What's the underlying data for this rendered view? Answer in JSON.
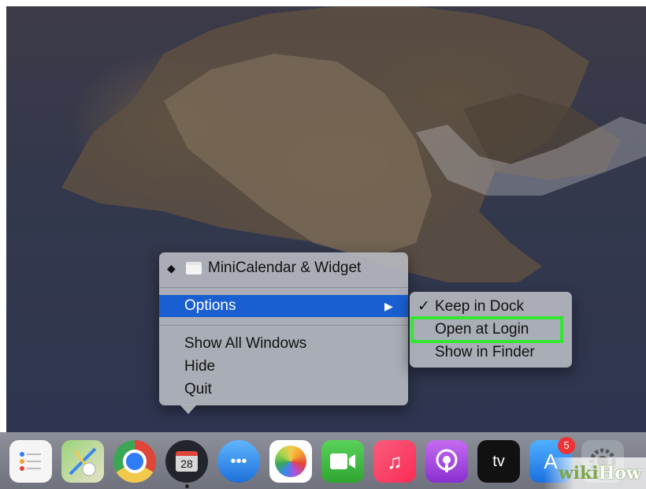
{
  "context_menu": {
    "app_title": "MiniCalendar & Widget",
    "items": [
      {
        "label": "Options",
        "selected": true,
        "has_submenu": true
      },
      {
        "label": "Show All Windows"
      },
      {
        "label": "Hide"
      },
      {
        "label": "Quit"
      }
    ]
  },
  "submenu": {
    "items": [
      {
        "label": "Keep in Dock",
        "checked": true
      },
      {
        "label": "Open at Login",
        "highlighted": true
      },
      {
        "label": "Show in Finder"
      }
    ]
  },
  "dock": {
    "icons": [
      {
        "name": "reminders",
        "icon": "list-icon"
      },
      {
        "name": "maps",
        "icon": "map-icon"
      },
      {
        "name": "chrome",
        "icon": "chrome-icon"
      },
      {
        "name": "minicalendar",
        "icon": "calendar-icon",
        "label": "28",
        "running": true
      },
      {
        "name": "messages",
        "icon": "chat-bubble-icon"
      },
      {
        "name": "photos",
        "icon": "flower-icon"
      },
      {
        "name": "facetime",
        "icon": "video-camera-icon"
      },
      {
        "name": "music",
        "icon": "music-note-icon"
      },
      {
        "name": "podcasts",
        "icon": "podcast-icon"
      },
      {
        "name": "apple-tv",
        "icon": "tv-icon",
        "label": "tv"
      },
      {
        "name": "app-store",
        "icon": "app-store-icon",
        "badge": "5"
      },
      {
        "name": "system-preferences",
        "icon": "gear-icon"
      }
    ]
  },
  "watermark": {
    "wiki": "wiki",
    "how": "How"
  },
  "colors": {
    "accent": "#1a5fd1",
    "highlight_box": "#34e634"
  }
}
